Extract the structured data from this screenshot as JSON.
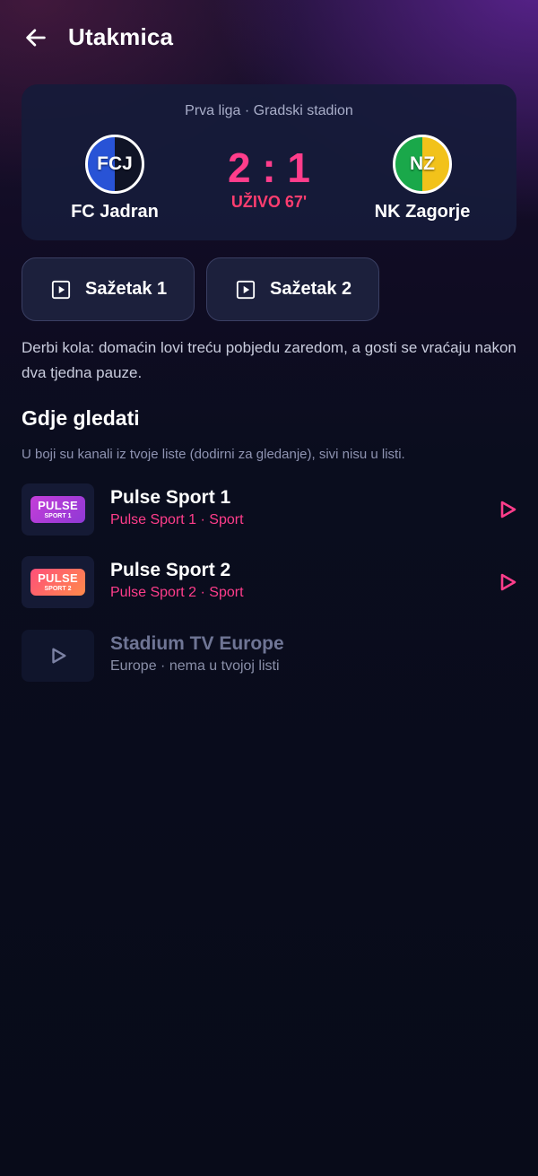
{
  "header": {
    "title": "Utakmica",
    "back_icon": "arrow-left-icon"
  },
  "match": {
    "league_venue": "Prva liga · Gradski stadion",
    "home": {
      "abbr": "FCJ",
      "name": "FC Jadran",
      "colors": [
        "#2853d6",
        "#101426"
      ]
    },
    "away": {
      "abbr": "NZ",
      "name": "NK Zagorje",
      "colors": [
        "#1aa84a",
        "#f2c21a"
      ]
    },
    "score": "2 : 1",
    "status": "UŽIVO 67'"
  },
  "highlights": [
    {
      "label": "Sažetak 1",
      "icon": "play-square-icon"
    },
    {
      "label": "Sažetak 2",
      "icon": "play-square-icon"
    }
  ],
  "description": "Derbi kola: domaćin lovi treću pobjedu zaredom, a gosti se vraćaju nakon dva tjedna pauze.",
  "where_to_watch": {
    "title": "Gdje gledati",
    "subtitle": "U boji su kanali iz tvoje liste (dodirni za gledanje), sivi nisu u listi.",
    "channels": [
      {
        "name": "Pulse Sport 1",
        "meta": "Pulse Sport 1 · Sport",
        "logo_top": "PULSE",
        "logo_bottom": "SPORT 1",
        "in_list": true
      },
      {
        "name": "Pulse Sport 2",
        "meta": "Pulse Sport 2 · Sport",
        "logo_top": "PULSE",
        "logo_bottom": "SPORT 2",
        "in_list": true
      },
      {
        "name": "Stadium TV Europe",
        "meta": "Europe · nema u tvojoj listi",
        "in_list": false
      }
    ]
  },
  "colors": {
    "accent": "#ff3d8b",
    "background": "#0a0d1e",
    "card": "#161b3a"
  }
}
